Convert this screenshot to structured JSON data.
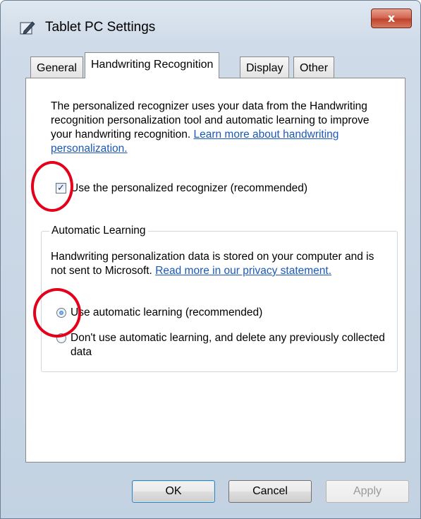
{
  "window": {
    "title": "Tablet PC Settings",
    "close_label": "x"
  },
  "tabs": [
    {
      "label": "General"
    },
    {
      "label": "Handwriting Recognition",
      "active": true
    },
    {
      "label": "Display"
    },
    {
      "label": "Other"
    }
  ],
  "recognizer": {
    "description": "The personalized recognizer uses your data from the Handwriting recognition personalization tool and automatic learning to improve your handwriting recognition. ",
    "link": "Learn more about handwriting personalization.",
    "checkbox_label": "Use the personalized recognizer (recommended)",
    "checkbox_checked": true
  },
  "automatic_learning": {
    "group_label": "Automatic Learning",
    "description": "Handwriting personalization data is stored on your computer and is not sent to Microsoft. ",
    "link": "Read more in our privacy statement.",
    "options": [
      {
        "label": "Use automatic learning (recommended)",
        "selected": true
      },
      {
        "label": "Don't use automatic learning, and delete any previously collected data",
        "selected": false
      }
    ]
  },
  "buttons": {
    "ok": "OK",
    "cancel": "Cancel",
    "apply": "Apply"
  },
  "colors": {
    "link": "#1b58b8",
    "annotation": "#e4001b"
  },
  "icons": [
    "tablet-pen-icon",
    "close-icon",
    "checkmark-icon",
    "radio-dot-icon"
  ]
}
